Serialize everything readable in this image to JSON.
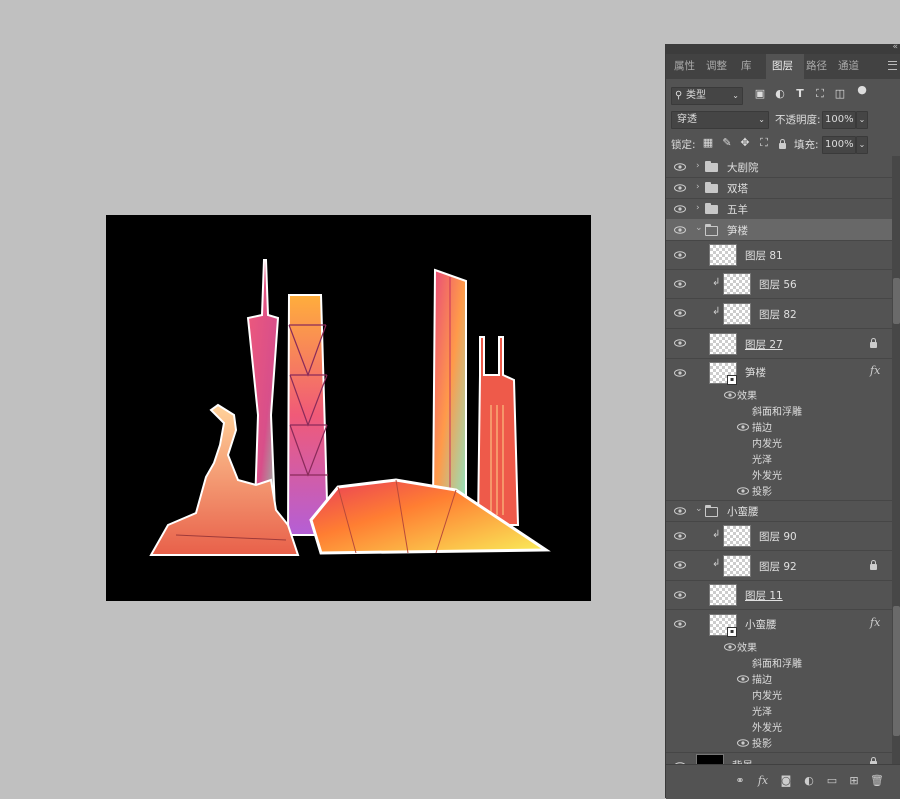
{
  "panel": {
    "tabs": [
      "属性",
      "调整",
      "库",
      "图层",
      "路径",
      "通道"
    ],
    "active_tab": "图层"
  },
  "filter": {
    "kind_label": "类型"
  },
  "blend": {
    "mode": "穿透",
    "opacity_label": "不透明度:",
    "opacity_value": "100%"
  },
  "lock": {
    "label": "锁定:",
    "fill_label": "填充:",
    "fill_value": "100%"
  },
  "layers": [
    {
      "type": "group",
      "name": "大剧院",
      "expanded": false
    },
    {
      "type": "group",
      "name": "双塔",
      "expanded": false
    },
    {
      "type": "group",
      "name": "五羊",
      "expanded": false
    },
    {
      "type": "group",
      "name": "笋楼",
      "expanded": true,
      "selected": true
    },
    {
      "type": "layer",
      "name": "图层 81"
    },
    {
      "type": "layer",
      "name": "图层 56",
      "clipped": true
    },
    {
      "type": "layer",
      "name": "图层 82",
      "clipped": true
    },
    {
      "type": "layer",
      "name": "图层 27",
      "locked": true
    },
    {
      "type": "smart",
      "name": "笋楼",
      "fx": "fx"
    },
    {
      "type": "group",
      "name": "小蛮腰",
      "expanded": true
    },
    {
      "type": "layer",
      "name": "图层 90",
      "clipped": true
    },
    {
      "type": "layer",
      "name": "图层 92",
      "clipped": true,
      "locked": true
    },
    {
      "type": "layer",
      "name": "图层 11"
    },
    {
      "type": "smart",
      "name": "小蛮腰",
      "fx": "fx"
    },
    {
      "type": "background",
      "name": "背景",
      "locked": true
    }
  ],
  "effects_label": "效果",
  "effects_a": [
    "斜面和浮雕",
    "描边",
    "内发光",
    "光泽",
    "外发光",
    "投影"
  ],
  "effects_b": [
    "斜面和浮雕",
    "描边",
    "内发光",
    "光泽",
    "外发光",
    "投影"
  ],
  "colors": {
    "canvas_bg": "#000000",
    "workspace": "#c0c0c0",
    "panel": "#535353"
  }
}
